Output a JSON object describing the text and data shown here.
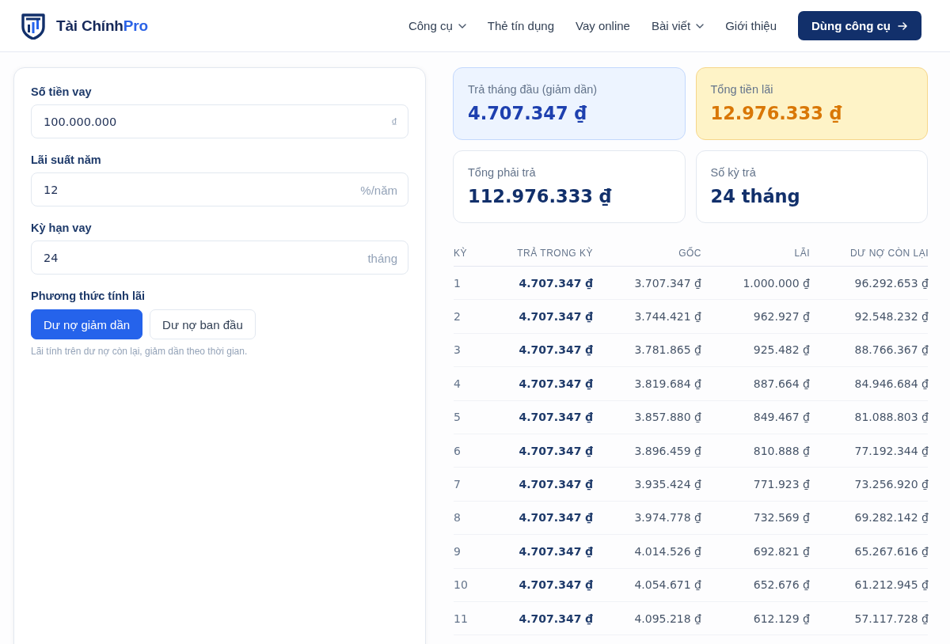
{
  "header": {
    "brand": {
      "name": "Tài Chính",
      "accent": "Pro"
    },
    "nav": [
      {
        "label": "Công cụ",
        "dropdown": true
      },
      {
        "label": "Thẻ tín dụng",
        "dropdown": false
      },
      {
        "label": "Vay online",
        "dropdown": false
      },
      {
        "label": "Bài viết",
        "dropdown": true
      },
      {
        "label": "Giới thiệu",
        "dropdown": false
      }
    ],
    "cta": "Dùng công cụ"
  },
  "form": {
    "fields": [
      {
        "label": "Số tiền vay",
        "value": "100.000.000",
        "unit": "₫"
      },
      {
        "label": "Lãi suất năm",
        "value": "12",
        "unit": "%/năm"
      },
      {
        "label": "Kỳ hạn vay",
        "value": "24",
        "unit": "tháng"
      }
    ],
    "method": {
      "label": "Phương thức tính lãi",
      "options": [
        {
          "label": "Dư nợ giảm dần",
          "selected": true
        },
        {
          "label": "Dư nợ ban đầu",
          "selected": false
        }
      ],
      "hint": "Lãi tính trên dư nợ còn lại, giảm dần theo thời gian."
    }
  },
  "summary": [
    {
      "kind": "primary",
      "label": "Trả tháng đầu (giảm dần)",
      "value": "4.707.347 ₫"
    },
    {
      "kind": "interest",
      "label": "Tổng tiền lãi",
      "value": "12.976.333 ₫"
    },
    {
      "kind": "plain",
      "label": "Tổng phải trả",
      "value": "112.976.333 ₫"
    },
    {
      "kind": "plain",
      "label": "Số kỳ trả",
      "value": "24 tháng"
    }
  ],
  "schedule": {
    "columns": [
      "KỲ",
      "TRẢ TRONG KỲ",
      "GỐC",
      "LÃI",
      "DƯ NỢ CÒN LẠI"
    ],
    "rows": [
      [
        "1",
        "4.707.347 ₫",
        "3.707.347 ₫",
        "1.000.000 ₫",
        "96.292.653 ₫"
      ],
      [
        "2",
        "4.707.347 ₫",
        "3.744.421 ₫",
        "962.927 ₫",
        "92.548.232 ₫"
      ],
      [
        "3",
        "4.707.347 ₫",
        "3.781.865 ₫",
        "925.482 ₫",
        "88.766.367 ₫"
      ],
      [
        "4",
        "4.707.347 ₫",
        "3.819.684 ₫",
        "887.664 ₫",
        "84.946.684 ₫"
      ],
      [
        "5",
        "4.707.347 ₫",
        "3.857.880 ₫",
        "849.467 ₫",
        "81.088.803 ₫"
      ],
      [
        "6",
        "4.707.347 ₫",
        "3.896.459 ₫",
        "810.888 ₫",
        "77.192.344 ₫"
      ],
      [
        "7",
        "4.707.347 ₫",
        "3.935.424 ₫",
        "771.923 ₫",
        "73.256.920 ₫"
      ],
      [
        "8",
        "4.707.347 ₫",
        "3.974.778 ₫",
        "732.569 ₫",
        "69.282.142 ₫"
      ],
      [
        "9",
        "4.707.347 ₫",
        "4.014.526 ₫",
        "692.821 ₫",
        "65.267.616 ₫"
      ],
      [
        "10",
        "4.707.347 ₫",
        "4.054.671 ₫",
        "652.676 ₫",
        "61.212.945 ₫"
      ],
      [
        "11",
        "4.707.347 ₫",
        "4.095.218 ₫",
        "612.129 ₫",
        "57.117.728 ₫"
      ]
    ]
  }
}
